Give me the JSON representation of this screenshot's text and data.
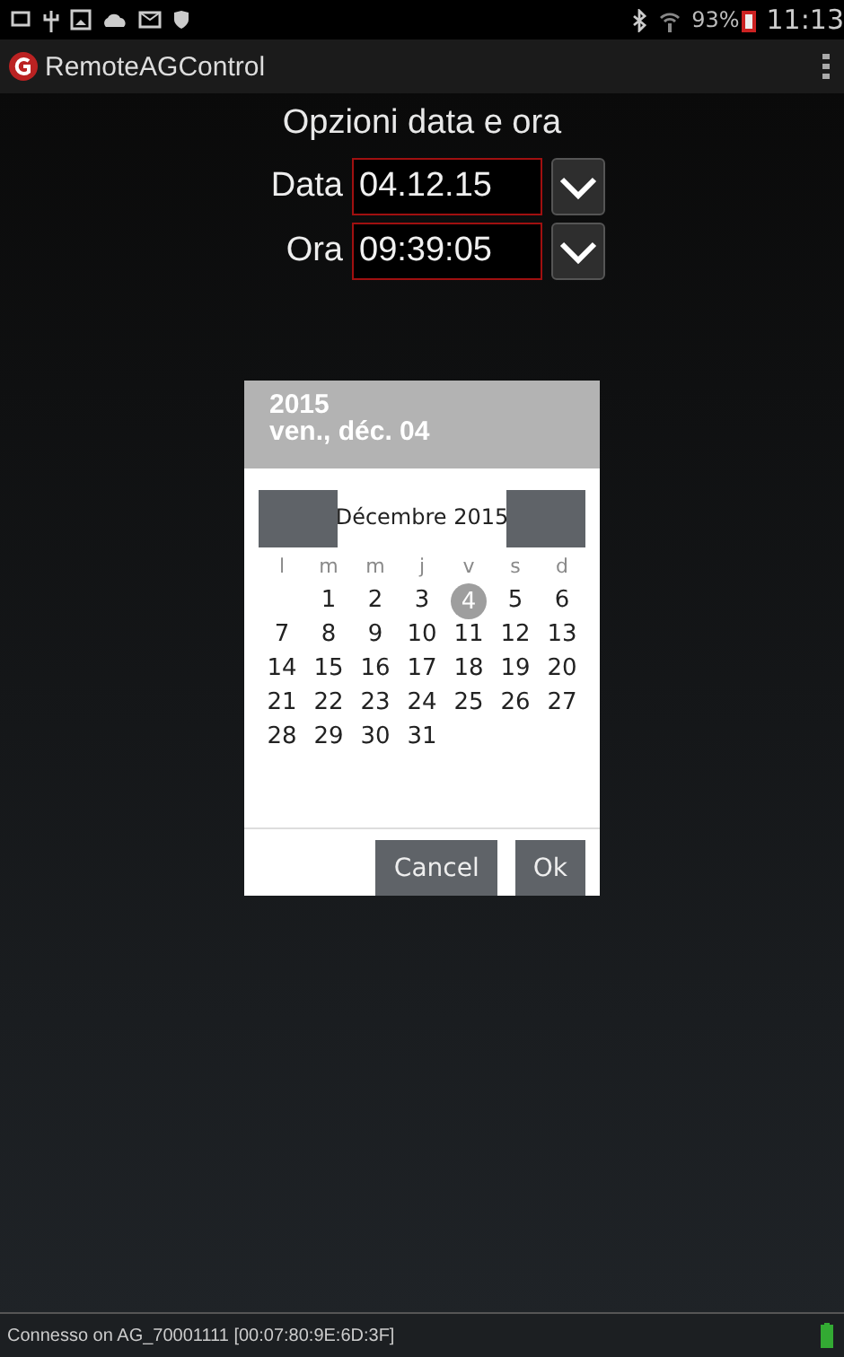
{
  "status_bar": {
    "battery": "93%",
    "time": "11:13"
  },
  "app_bar": {
    "title": "RemoteAGControl"
  },
  "heading": "Opzioni data e ora",
  "fields": [
    {
      "label": "Data",
      "value": "04.12.15"
    },
    {
      "label": "Ora",
      "value": "09:39:05"
    }
  ],
  "date_picker": {
    "year": "2015",
    "date": "ven., déc. 04",
    "month": "Décembre 2015",
    "weekdays": [
      "l",
      "m",
      "m",
      "j",
      "v",
      "s",
      "d"
    ],
    "weeks": [
      [
        {
          "day": "1",
          "selected": false
        },
        {
          "day": "2",
          "selected": false
        },
        {
          "day": "3",
          "selected": false
        },
        {
          "day": "4",
          "selected": true
        },
        {
          "day": "5",
          "selected": false
        },
        {
          "day": "6",
          "selected": false
        }
      ],
      [
        {
          "day": "7",
          "selected": false
        },
        {
          "day": "8",
          "selected": false
        },
        {
          "day": "9",
          "selected": false
        },
        {
          "day": "10",
          "selected": false
        },
        {
          "day": "11",
          "selected": false
        },
        {
          "day": "12",
          "selected": false
        },
        {
          "day": "13",
          "selected": false
        }
      ],
      [
        {
          "day": "14",
          "selected": false
        },
        {
          "day": "15",
          "selected": false
        },
        {
          "day": "16",
          "selected": false
        },
        {
          "day": "17",
          "selected": false
        },
        {
          "day": "18",
          "selected": false
        },
        {
          "day": "19",
          "selected": false
        },
        {
          "day": "20",
          "selected": false
        }
      ],
      [
        {
          "day": "21",
          "selected": false
        },
        {
          "day": "22",
          "selected": false
        },
        {
          "day": "23",
          "selected": false
        },
        {
          "day": "24",
          "selected": false
        },
        {
          "day": "25",
          "selected": false
        },
        {
          "day": "26",
          "selected": false
        },
        {
          "day": "27",
          "selected": false
        }
      ],
      [
        {
          "day": "28",
          "selected": false
        },
        {
          "day": "29",
          "selected": false
        },
        {
          "day": "30",
          "selected": false
        },
        {
          "day": "31",
          "selected": false
        }
      ]
    ],
    "buttons": [
      "Cancel",
      "Ok"
    ]
  },
  "footer": {
    "connection": "Connesso on AG_70001111 [00:07:80:9E:6D:3F]"
  }
}
